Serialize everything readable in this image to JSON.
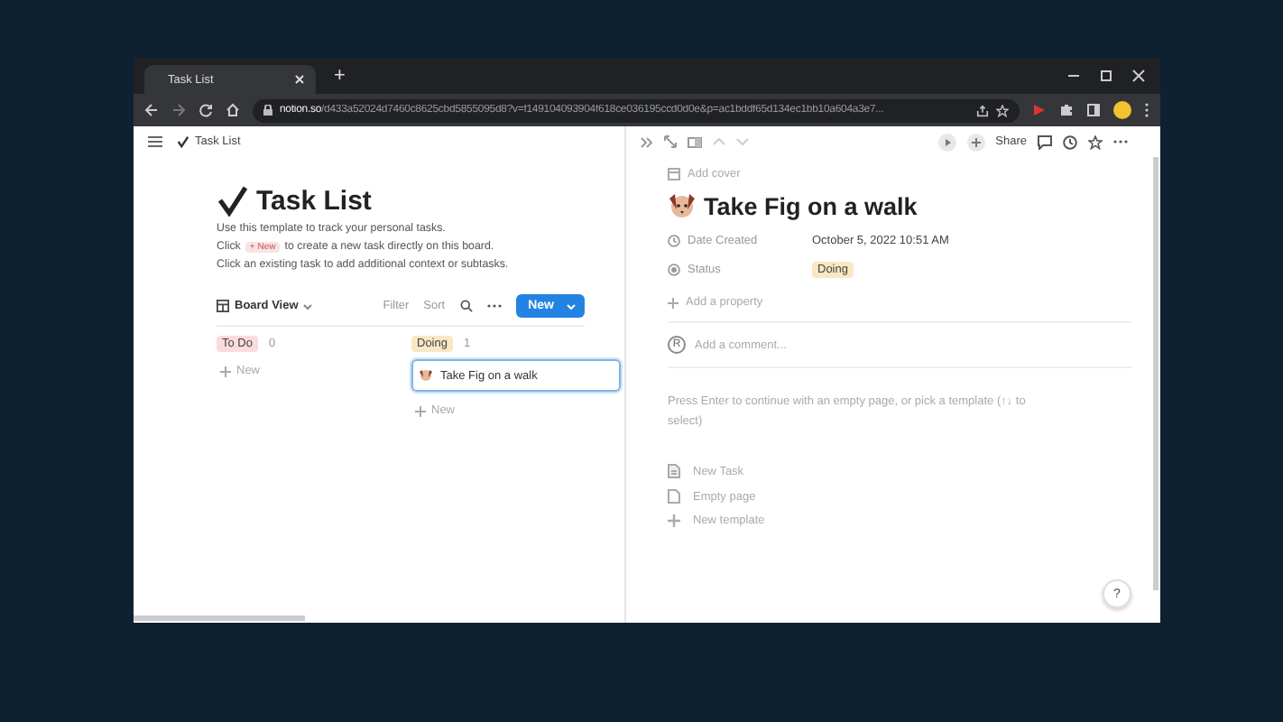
{
  "browser": {
    "tab_title": "Task List",
    "new_tab": "+",
    "url_domain": "notion.so",
    "url_path": "/d433a52024d7460c8625cbd5855095d8?v=f149104093904f618ce036195ccd0d0e&p=ac1bddf65d134ec1bb10a604a3e7..."
  },
  "topbar": {
    "breadcrumb": "Task List"
  },
  "page": {
    "title": "Task List",
    "intro_1": "Use this template to track your personal tasks.",
    "intro_2_before": "Click",
    "intro_2_chip": "+ New",
    "intro_2_after": "to create a new task directly on this board.",
    "intro_3": "Click an existing task to add additional context or subtasks."
  },
  "board": {
    "view": "Board View",
    "actions": [
      "Filter",
      "Sort"
    ],
    "new_button": "New",
    "columns": [
      {
        "name": "To Do",
        "count": "0",
        "color": "#fadcdc",
        "add": "New"
      },
      {
        "name": "Doing",
        "count": "1",
        "color": "#f8e8c4",
        "cards": [
          {
            "title": "Take Fig on a walk",
            "selected": true
          }
        ],
        "add": "New"
      }
    ]
  },
  "peek": {
    "share": "Share",
    "add_cover": "Add cover",
    "title": "Take Fig on a walk",
    "properties": [
      {
        "kind": "date",
        "label": "Date Created",
        "value": "October 5, 2022 10:51 AM"
      },
      {
        "kind": "status",
        "label": "Status",
        "value": "Doing",
        "color": "#f8e8c4"
      }
    ],
    "add_property": "Add a property",
    "comment_avatar": "R",
    "comment_placeholder": "Add a comment...",
    "hint": "Press Enter to continue with an empty page, or pick a template (↑↓ to select)",
    "templates": [
      {
        "kind": "task",
        "label": "New Task"
      },
      {
        "kind": "page",
        "label": "Empty page"
      },
      {
        "kind": "add",
        "label": "New template"
      }
    ],
    "help": "?"
  }
}
